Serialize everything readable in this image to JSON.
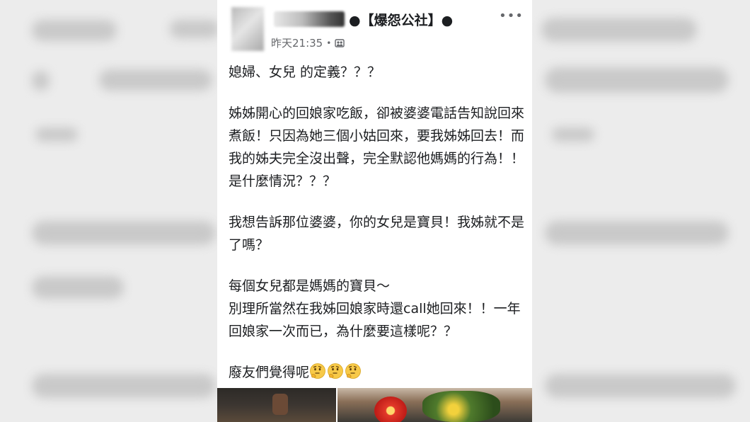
{
  "post": {
    "group_name": "●【爆怨公社】●",
    "timestamp": "昨天21:35",
    "separator": "•",
    "more_label": "•••",
    "paragraphs": [
      "媳婦、女兒 的定義？？？",
      "姊姊開心的回娘家吃飯，卻被婆婆電話告知說回來煮飯！只因為她三個小姑回來，要我姊姊回去！而我的姊夫完全沒出聲，完全默認他媽媽的行為！！是什麼情況？？？",
      "我想告訴那位婆婆，你的女兒是寶貝！我姊就不是了嗎？",
      "每個女兒都是媽媽的寶貝～\n別理所當然在我姊回娘家時還call她回來！！一年回娘家一次而已，為什麼要這樣呢？？"
    ],
    "last_line": "廢友們覺得呢",
    "emojis": [
      "thinking-face-icon",
      "thinking-face-icon",
      "thinking-face-icon"
    ],
    "colors": {
      "text": "#1c1e21",
      "meta": "#65676b",
      "emoji": "#f7c948"
    }
  }
}
